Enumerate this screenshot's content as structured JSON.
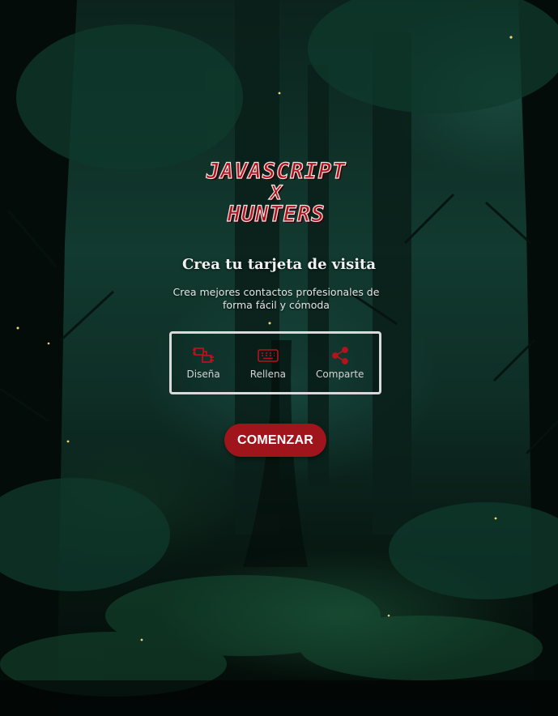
{
  "logo": {
    "line1": "JAVASCRIPT",
    "line2": "X",
    "line3": "HUNTERS"
  },
  "hero": {
    "title": "Crea tu tarjeta de visita",
    "subtitle": "Crea mejores contactos profesionales de forma fácil y cómoda"
  },
  "steps": [
    {
      "label": "Diseña",
      "icon": "design-icon"
    },
    {
      "label": "Rellena",
      "icon": "keyboard-icon"
    },
    {
      "label": "Comparte",
      "icon": "share-icon"
    }
  ],
  "cta": {
    "label": "COMENZAR"
  },
  "colors": {
    "accent": "#a0141b",
    "icon": "#b3141c",
    "border": "#d9d9d9",
    "text": "#f1f1f1"
  }
}
